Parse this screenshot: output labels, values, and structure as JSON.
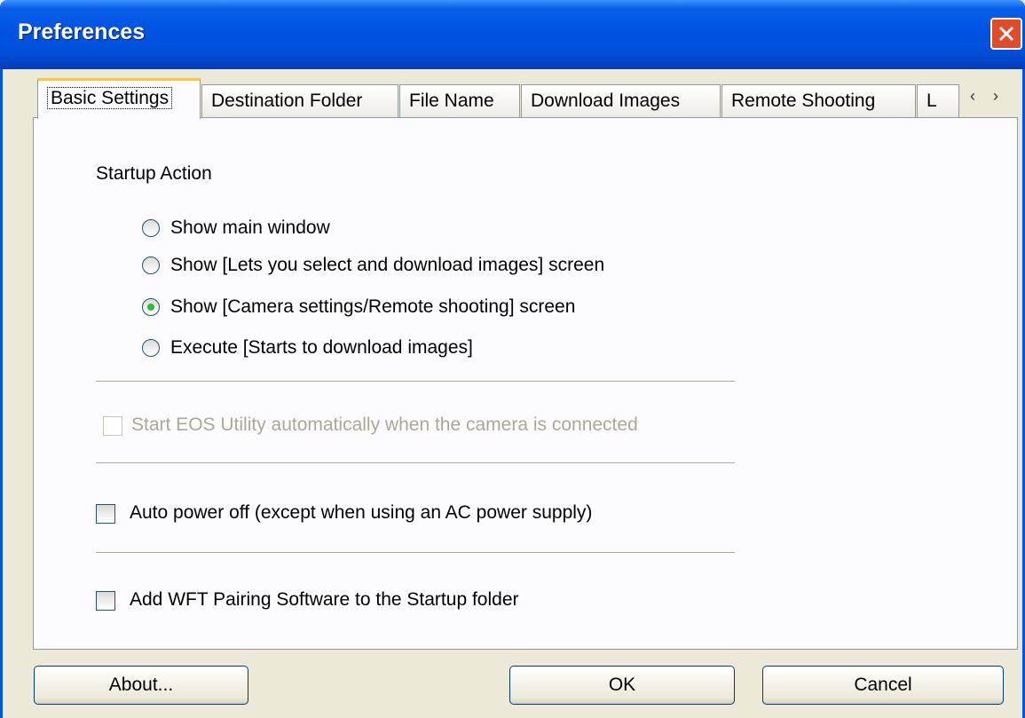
{
  "window": {
    "title": "Preferences"
  },
  "tabs": [
    {
      "label": "Basic Settings",
      "active": true
    },
    {
      "label": "Destination Folder",
      "active": false
    },
    {
      "label": "File Name",
      "active": false
    },
    {
      "label": "Download Images",
      "active": false
    },
    {
      "label": "Remote Shooting",
      "active": false
    },
    {
      "label": "L",
      "active": false
    }
  ],
  "tab_scroll": {
    "left": "‹",
    "right": "›"
  },
  "startup": {
    "label": "Startup Action",
    "options": [
      {
        "label": "Show main window",
        "checked": false
      },
      {
        "label": "Show [Lets you select and download images] screen",
        "checked": false
      },
      {
        "label": "Show [Camera settings/Remote shooting] screen",
        "checked": true
      },
      {
        "label": "Execute [Starts to download images]",
        "checked": false
      }
    ]
  },
  "checkboxes": [
    {
      "label": "Start EOS Utility automatically when the camera is connected",
      "checked": false,
      "disabled": true
    },
    {
      "label": "Auto power off (except when using an AC power supply)",
      "checked": false,
      "disabled": false
    },
    {
      "label": "Add WFT Pairing Software to the Startup folder",
      "checked": false,
      "disabled": false
    }
  ],
  "buttons": {
    "about": "About...",
    "ok": "OK",
    "cancel": "Cancel"
  },
  "colors": {
    "titlebar": "#0054e3",
    "close": "#e24a2a",
    "active_tab_accent": "#ffc83c",
    "radio_dot": "#2cbe32"
  }
}
